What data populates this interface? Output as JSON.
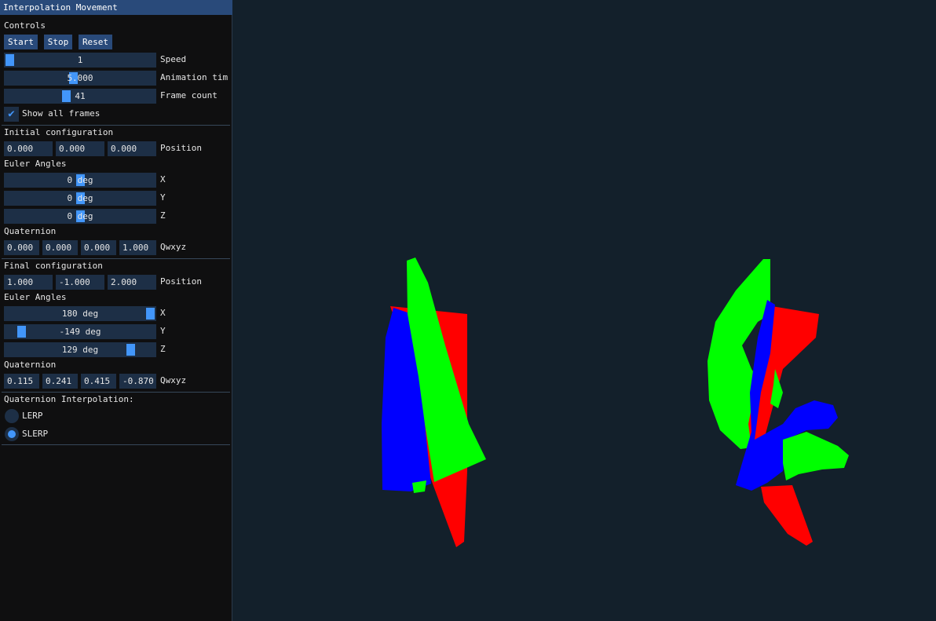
{
  "window": {
    "title": "Interpolation Movement"
  },
  "controls": {
    "heading": "Controls",
    "start_label": "Start",
    "stop_label": "Stop",
    "reset_label": "Reset",
    "speed": {
      "value": "1",
      "label": "Speed",
      "fraction": 0.0
    },
    "animation_time": {
      "value": "5.000",
      "label": "Animation tim",
      "fraction": 0.45
    },
    "frame_count": {
      "value": "41",
      "label": "Frame count",
      "fraction": 0.4
    },
    "show_all_frames": {
      "label": "Show all frames",
      "checked": true
    }
  },
  "initial": {
    "heading": "Initial configuration",
    "position": [
      "0.000",
      "0.000",
      "0.000"
    ],
    "position_label": "Position",
    "euler_heading": "Euler Angles",
    "euler": [
      {
        "value": "0 deg",
        "axis": "X",
        "fraction": 0.5
      },
      {
        "value": "0 deg",
        "axis": "Y",
        "fraction": 0.5
      },
      {
        "value": "0 deg",
        "axis": "Z",
        "fraction": 0.5
      }
    ],
    "quat_heading": "Quaternion",
    "quaternion": [
      "0.000",
      "0.000",
      "0.000",
      "1.000"
    ],
    "quat_label": "Qwxyz"
  },
  "final": {
    "heading": "Final configuration",
    "position": [
      "1.000",
      "-1.000",
      "2.000"
    ],
    "position_label": "Position",
    "euler_heading": "Euler Angles",
    "euler": [
      {
        "value": "180 deg",
        "axis": "X",
        "fraction": 1.0
      },
      {
        "value": "-149 deg",
        "axis": "Y",
        "fraction": 0.086
      },
      {
        "value": "129 deg",
        "axis": "Z",
        "fraction": 0.858
      }
    ],
    "quat_heading": "Quaternion",
    "quaternion": [
      "0.115",
      "0.241",
      "0.415",
      "-0.870"
    ],
    "quat_label": "Qwxyz"
  },
  "interpolation": {
    "heading": "Quaternion Interpolation:",
    "options": [
      {
        "label": "LERP",
        "selected": false
      },
      {
        "label": "SLERP",
        "selected": true
      }
    ]
  },
  "colors": {
    "background": "#13202b",
    "panel": "#0f0f10",
    "accent": "#4296fa",
    "axis_x": "#ff0000",
    "axis_y": "#00ff00",
    "axis_z": "#0000ff"
  }
}
